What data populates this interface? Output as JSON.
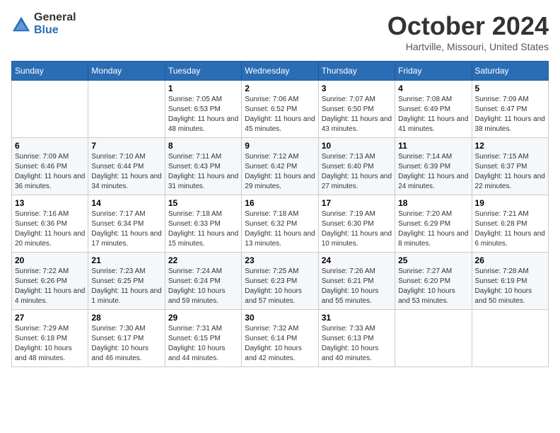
{
  "logo": {
    "general": "General",
    "blue": "Blue"
  },
  "title": "October 2024",
  "location": "Hartville, Missouri, United States",
  "days_of_week": [
    "Sunday",
    "Monday",
    "Tuesday",
    "Wednesday",
    "Thursday",
    "Friday",
    "Saturday"
  ],
  "weeks": [
    [
      {
        "day": "",
        "info": ""
      },
      {
        "day": "",
        "info": ""
      },
      {
        "day": "1",
        "info": "Sunrise: 7:05 AM\nSunset: 6:53 PM\nDaylight: 11 hours and 48 minutes."
      },
      {
        "day": "2",
        "info": "Sunrise: 7:06 AM\nSunset: 6:52 PM\nDaylight: 11 hours and 45 minutes."
      },
      {
        "day": "3",
        "info": "Sunrise: 7:07 AM\nSunset: 6:50 PM\nDaylight: 11 hours and 43 minutes."
      },
      {
        "day": "4",
        "info": "Sunrise: 7:08 AM\nSunset: 6:49 PM\nDaylight: 11 hours and 41 minutes."
      },
      {
        "day": "5",
        "info": "Sunrise: 7:09 AM\nSunset: 6:47 PM\nDaylight: 11 hours and 38 minutes."
      }
    ],
    [
      {
        "day": "6",
        "info": "Sunrise: 7:09 AM\nSunset: 6:46 PM\nDaylight: 11 hours and 36 minutes."
      },
      {
        "day": "7",
        "info": "Sunrise: 7:10 AM\nSunset: 6:44 PM\nDaylight: 11 hours and 34 minutes."
      },
      {
        "day": "8",
        "info": "Sunrise: 7:11 AM\nSunset: 6:43 PM\nDaylight: 11 hours and 31 minutes."
      },
      {
        "day": "9",
        "info": "Sunrise: 7:12 AM\nSunset: 6:42 PM\nDaylight: 11 hours and 29 minutes."
      },
      {
        "day": "10",
        "info": "Sunrise: 7:13 AM\nSunset: 6:40 PM\nDaylight: 11 hours and 27 minutes."
      },
      {
        "day": "11",
        "info": "Sunrise: 7:14 AM\nSunset: 6:39 PM\nDaylight: 11 hours and 24 minutes."
      },
      {
        "day": "12",
        "info": "Sunrise: 7:15 AM\nSunset: 6:37 PM\nDaylight: 11 hours and 22 minutes."
      }
    ],
    [
      {
        "day": "13",
        "info": "Sunrise: 7:16 AM\nSunset: 6:36 PM\nDaylight: 11 hours and 20 minutes."
      },
      {
        "day": "14",
        "info": "Sunrise: 7:17 AM\nSunset: 6:34 PM\nDaylight: 11 hours and 17 minutes."
      },
      {
        "day": "15",
        "info": "Sunrise: 7:18 AM\nSunset: 6:33 PM\nDaylight: 11 hours and 15 minutes."
      },
      {
        "day": "16",
        "info": "Sunrise: 7:18 AM\nSunset: 6:32 PM\nDaylight: 11 hours and 13 minutes."
      },
      {
        "day": "17",
        "info": "Sunrise: 7:19 AM\nSunset: 6:30 PM\nDaylight: 11 hours and 10 minutes."
      },
      {
        "day": "18",
        "info": "Sunrise: 7:20 AM\nSunset: 6:29 PM\nDaylight: 11 hours and 8 minutes."
      },
      {
        "day": "19",
        "info": "Sunrise: 7:21 AM\nSunset: 6:28 PM\nDaylight: 11 hours and 6 minutes."
      }
    ],
    [
      {
        "day": "20",
        "info": "Sunrise: 7:22 AM\nSunset: 6:26 PM\nDaylight: 11 hours and 4 minutes."
      },
      {
        "day": "21",
        "info": "Sunrise: 7:23 AM\nSunset: 6:25 PM\nDaylight: 11 hours and 1 minute."
      },
      {
        "day": "22",
        "info": "Sunrise: 7:24 AM\nSunset: 6:24 PM\nDaylight: 10 hours and 59 minutes."
      },
      {
        "day": "23",
        "info": "Sunrise: 7:25 AM\nSunset: 6:23 PM\nDaylight: 10 hours and 57 minutes."
      },
      {
        "day": "24",
        "info": "Sunrise: 7:26 AM\nSunset: 6:21 PM\nDaylight: 10 hours and 55 minutes."
      },
      {
        "day": "25",
        "info": "Sunrise: 7:27 AM\nSunset: 6:20 PM\nDaylight: 10 hours and 53 minutes."
      },
      {
        "day": "26",
        "info": "Sunrise: 7:28 AM\nSunset: 6:19 PM\nDaylight: 10 hours and 50 minutes."
      }
    ],
    [
      {
        "day": "27",
        "info": "Sunrise: 7:29 AM\nSunset: 6:18 PM\nDaylight: 10 hours and 48 minutes."
      },
      {
        "day": "28",
        "info": "Sunrise: 7:30 AM\nSunset: 6:17 PM\nDaylight: 10 hours and 46 minutes."
      },
      {
        "day": "29",
        "info": "Sunrise: 7:31 AM\nSunset: 6:15 PM\nDaylight: 10 hours and 44 minutes."
      },
      {
        "day": "30",
        "info": "Sunrise: 7:32 AM\nSunset: 6:14 PM\nDaylight: 10 hours and 42 minutes."
      },
      {
        "day": "31",
        "info": "Sunrise: 7:33 AM\nSunset: 6:13 PM\nDaylight: 10 hours and 40 minutes."
      },
      {
        "day": "",
        "info": ""
      },
      {
        "day": "",
        "info": ""
      }
    ]
  ]
}
